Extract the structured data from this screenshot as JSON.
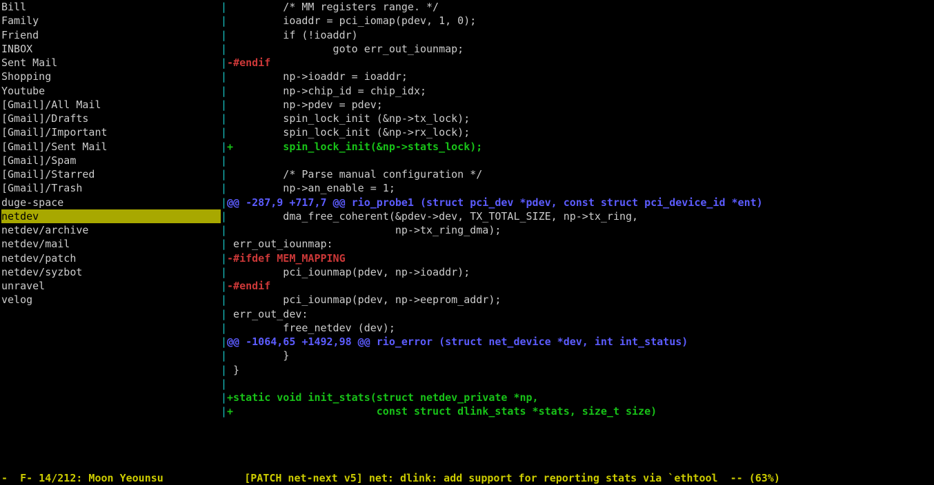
{
  "sidebar": {
    "items": [
      {
        "label": "Bill",
        "selected": false
      },
      {
        "label": "Family",
        "selected": false
      },
      {
        "label": "Friend",
        "selected": false
      },
      {
        "label": "INBOX",
        "selected": false
      },
      {
        "label": "Sent Mail",
        "selected": false
      },
      {
        "label": "Shopping",
        "selected": false
      },
      {
        "label": "Youtube",
        "selected": false
      },
      {
        "label": "[Gmail]/All Mail",
        "selected": false
      },
      {
        "label": "[Gmail]/Drafts",
        "selected": false
      },
      {
        "label": "[Gmail]/Important",
        "selected": false
      },
      {
        "label": "[Gmail]/Sent Mail",
        "selected": false
      },
      {
        "label": "[Gmail]/Spam",
        "selected": false
      },
      {
        "label": "[Gmail]/Starred",
        "selected": false
      },
      {
        "label": "[Gmail]/Trash",
        "selected": false
      },
      {
        "label": "duge-space",
        "selected": false
      },
      {
        "label": "netdev",
        "selected": true
      },
      {
        "label": "netdev/archive",
        "selected": false
      },
      {
        "label": "netdev/mail",
        "selected": false
      },
      {
        "label": "netdev/patch",
        "selected": false
      },
      {
        "label": "netdev/syzbot",
        "selected": false
      },
      {
        "label": "unravel",
        "selected": false
      },
      {
        "label": "velog",
        "selected": false
      }
    ]
  },
  "sep": "|",
  "content": {
    "lines": [
      {
        "segments": [
          {
            "cls": "sep-cyan",
            "t": "|"
          },
          {
            "cls": "plain",
            "t": "         /* MM registers range. */"
          }
        ]
      },
      {
        "segments": [
          {
            "cls": "sep-cyan",
            "t": "|"
          },
          {
            "cls": "plain",
            "t": "         ioaddr = pci_iomap(pdev, 1, 0);"
          }
        ]
      },
      {
        "segments": [
          {
            "cls": "sep-cyan",
            "t": "|"
          },
          {
            "cls": "plain",
            "t": "         if (!ioaddr)"
          }
        ]
      },
      {
        "segments": [
          {
            "cls": "sep-cyan",
            "t": "|"
          },
          {
            "cls": "plain",
            "t": "                 goto err_out_iounmap;"
          }
        ]
      },
      {
        "segments": [
          {
            "cls": "sep-cyan",
            "t": "|"
          },
          {
            "cls": "diff-del",
            "t": "-#endif"
          }
        ]
      },
      {
        "segments": [
          {
            "cls": "sep-cyan",
            "t": "|"
          },
          {
            "cls": "plain",
            "t": "         np->ioaddr = ioaddr;"
          }
        ]
      },
      {
        "segments": [
          {
            "cls": "sep-cyan",
            "t": "|"
          },
          {
            "cls": "plain",
            "t": "         np->chip_id = chip_idx;"
          }
        ]
      },
      {
        "segments": [
          {
            "cls": "sep-cyan",
            "t": "|"
          },
          {
            "cls": "plain",
            "t": "         np->pdev = pdev;"
          }
        ]
      },
      {
        "segments": [
          {
            "cls": "sep-cyan",
            "t": "|"
          },
          {
            "cls": "plain",
            "t": "         spin_lock_init (&np->tx_lock);"
          }
        ]
      },
      {
        "segments": [
          {
            "cls": "sep-cyan",
            "t": "|"
          },
          {
            "cls": "plain",
            "t": "         spin_lock_init (&np->rx_lock);"
          }
        ]
      },
      {
        "segments": [
          {
            "cls": "sep-cyan",
            "t": "|"
          },
          {
            "cls": "diff-add",
            "t": "+        spin_lock_init(&np->stats_lock);"
          }
        ]
      },
      {
        "segments": [
          {
            "cls": "sep-cyan",
            "t": "|"
          }
        ]
      },
      {
        "segments": [
          {
            "cls": "sep-cyan",
            "t": "|"
          },
          {
            "cls": "plain",
            "t": "         /* Parse manual configuration */"
          }
        ]
      },
      {
        "segments": [
          {
            "cls": "sep-cyan",
            "t": "|"
          },
          {
            "cls": "plain",
            "t": "         np->an_enable = 1;"
          }
        ]
      },
      {
        "segments": [
          {
            "cls": "sep-cyan",
            "t": "|"
          },
          {
            "cls": "diff-hunk",
            "t": "@@ -287,9 +717,7 @@ rio_probe1 (struct pci_dev *pdev, const struct pci_device_id *ent)"
          }
        ]
      },
      {
        "segments": [
          {
            "cls": "sep-cyan",
            "t": "|"
          },
          {
            "cls": "plain",
            "t": "         dma_free_coherent(&pdev->dev, TX_TOTAL_SIZE, np->tx_ring,"
          }
        ]
      },
      {
        "segments": [
          {
            "cls": "sep-cyan",
            "t": "|"
          },
          {
            "cls": "plain",
            "t": "                           np->tx_ring_dma);"
          }
        ]
      },
      {
        "segments": [
          {
            "cls": "sep-cyan",
            "t": "|"
          },
          {
            "cls": "plain",
            "t": " err_out_iounmap:"
          }
        ]
      },
      {
        "segments": [
          {
            "cls": "sep-cyan",
            "t": "|"
          },
          {
            "cls": "diff-del",
            "t": "-#ifdef MEM_MAPPING"
          }
        ]
      },
      {
        "segments": [
          {
            "cls": "sep-cyan",
            "t": "|"
          },
          {
            "cls": "plain",
            "t": "         pci_iounmap(pdev, np->ioaddr);"
          }
        ]
      },
      {
        "segments": [
          {
            "cls": "sep-cyan",
            "t": "|"
          },
          {
            "cls": "diff-del",
            "t": "-#endif"
          }
        ]
      },
      {
        "segments": [
          {
            "cls": "sep-cyan",
            "t": "|"
          },
          {
            "cls": "plain",
            "t": "         pci_iounmap(pdev, np->eeprom_addr);"
          }
        ]
      },
      {
        "segments": [
          {
            "cls": "sep-cyan",
            "t": "|"
          },
          {
            "cls": "plain",
            "t": " err_out_dev:"
          }
        ]
      },
      {
        "segments": [
          {
            "cls": "sep-cyan",
            "t": "|"
          },
          {
            "cls": "plain",
            "t": "         free_netdev (dev);"
          }
        ]
      },
      {
        "segments": [
          {
            "cls": "sep-cyan",
            "t": "|"
          },
          {
            "cls": "diff-hunk",
            "t": "@@ -1064,65 +1492,98 @@ rio_error (struct net_device *dev, int int_status)"
          }
        ]
      },
      {
        "segments": [
          {
            "cls": "sep-cyan",
            "t": "|"
          },
          {
            "cls": "plain",
            "t": "         }"
          }
        ]
      },
      {
        "segments": [
          {
            "cls": "sep-cyan",
            "t": "|"
          },
          {
            "cls": "plain",
            "t": " }"
          }
        ]
      },
      {
        "segments": [
          {
            "cls": "sep-cyan",
            "t": "|"
          }
        ]
      },
      {
        "segments": [
          {
            "cls": "sep-cyan",
            "t": "|"
          },
          {
            "cls": "diff-add",
            "t": "+static void init_stats(struct netdev_private *np,"
          }
        ]
      },
      {
        "segments": [
          {
            "cls": "sep-cyan",
            "t": "|"
          },
          {
            "cls": "diff-add",
            "t": "+                       const struct dlink_stats *stats, size_t size)"
          }
        ]
      }
    ]
  },
  "statusbar": {
    "text": "-  F- 14/212: Moon Yeounsu             [PATCH net-next v5] net: dlink: add support for reporting stats via `ethtool  -- (63%)"
  }
}
